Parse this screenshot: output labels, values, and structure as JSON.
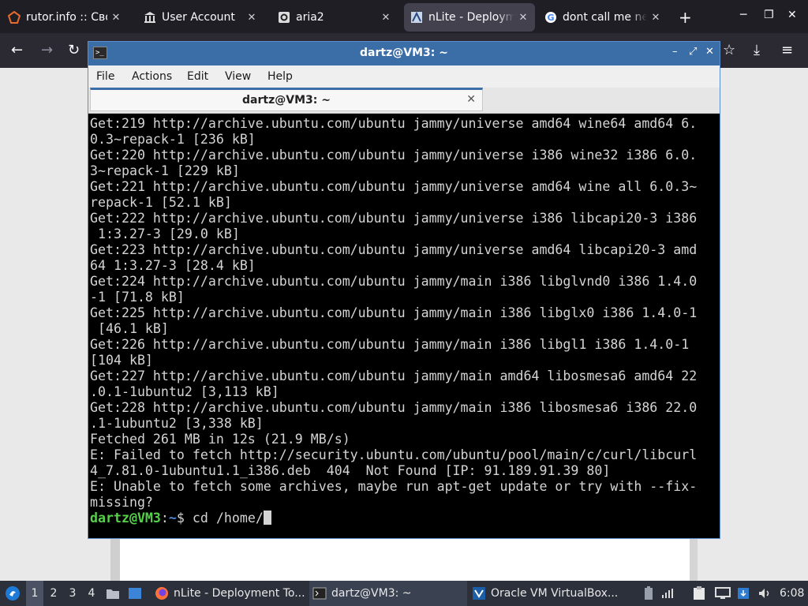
{
  "browser": {
    "tabs": [
      {
        "title": "rutor.info :: Своб",
        "icon": "rutor-icon"
      },
      {
        "title": "User Account",
        "icon": "bank-icon"
      },
      {
        "title": "aria2",
        "icon": "aria2-icon"
      },
      {
        "title": "nLite - Deployme",
        "icon": "nlite-icon"
      },
      {
        "title": "dont call me nez",
        "icon": "google-icon"
      }
    ],
    "new_tab": "+",
    "window_controls": {
      "minimize": "─",
      "maximize": "❐",
      "close": "✕"
    },
    "nav": {
      "back": "←",
      "forward": "→",
      "reload": "↻",
      "star": "☆",
      "download": "⤓",
      "menu": "≡"
    }
  },
  "terminal": {
    "title": "dartz@VM3: ~",
    "title_controls": {
      "minimize": "–",
      "maximize": "⤢",
      "close": "✕"
    },
    "menu": [
      "File",
      "Actions",
      "Edit",
      "View",
      "Help"
    ],
    "tab_title": "dartz@VM3: ~",
    "tab_close": "✕",
    "output": "Get:219 http://archive.ubuntu.com/ubuntu jammy/universe amd64 wine64 amd64 6.\n0.3~repack-1 [236 kB]\nGet:220 http://archive.ubuntu.com/ubuntu jammy/universe i386 wine32 i386 6.0.\n3~repack-1 [229 kB]\nGet:221 http://archive.ubuntu.com/ubuntu jammy/universe amd64 wine all 6.0.3~\nrepack-1 [52.1 kB]\nGet:222 http://archive.ubuntu.com/ubuntu jammy/universe i386 libcapi20-3 i386\n 1:3.27-3 [29.0 kB]\nGet:223 http://archive.ubuntu.com/ubuntu jammy/universe amd64 libcapi20-3 amd\n64 1:3.27-3 [28.4 kB]\nGet:224 http://archive.ubuntu.com/ubuntu jammy/main i386 libglvnd0 i386 1.4.0\n-1 [71.8 kB]\nGet:225 http://archive.ubuntu.com/ubuntu jammy/main i386 libglx0 i386 1.4.0-1\n [46.1 kB]\nGet:226 http://archive.ubuntu.com/ubuntu jammy/main i386 libgl1 i386 1.4.0-1\n[104 kB]\nGet:227 http://archive.ubuntu.com/ubuntu jammy/main amd64 libosmesa6 amd64 22\n.0.1-1ubuntu2 [3,113 kB]\nGet:228 http://archive.ubuntu.com/ubuntu jammy/main i386 libosmesa6 i386 22.0\n.1-1ubuntu2 [3,338 kB]\nFetched 261 MB in 12s (21.9 MB/s)\nE: Failed to fetch http://security.ubuntu.com/ubuntu/pool/main/c/curl/libcurl\n4_7.81.0-1ubuntu1.1_i386.deb  404  Not Found [IP: 91.189.91.39 80]\nE: Unable to fetch some archives, maybe run apt-get update or try with --fix-\nmissing?",
    "prompt_user": "dartz@VM3",
    "prompt_sep": ":",
    "prompt_path": "~",
    "prompt_symbol": "$",
    "command": " cd /home/"
  },
  "taskbar": {
    "workspaces": [
      "1",
      "2",
      "3",
      "4"
    ],
    "active_workspace": "1",
    "tasks": [
      {
        "title": "nLite - Deployment To...",
        "icon": "firefox-icon"
      },
      {
        "title": "dartz@VM3: ~",
        "icon": "terminal-icon"
      },
      {
        "title": "Oracle VM VirtualBox...",
        "icon": "virtualbox-icon"
      }
    ],
    "clock": "6:08"
  }
}
